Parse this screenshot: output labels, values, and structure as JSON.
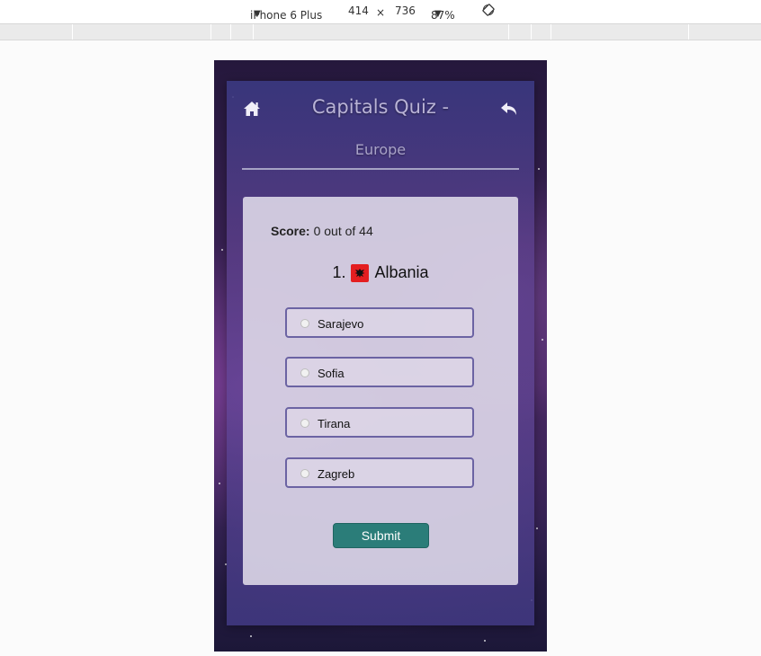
{
  "devtools": {
    "device": "iPhone 6 Plus",
    "width": "414",
    "times": "×",
    "height": "736",
    "zoom": "87%",
    "caret": "▼"
  },
  "header": {
    "title": "Capitals Quiz -",
    "subtitle": "Europe"
  },
  "quiz": {
    "score_label": "Score:",
    "score_value": "0 out of 44",
    "question_number": "1.",
    "country": "Albania",
    "options": [
      "Sarajevo",
      "Sofia",
      "Tirana",
      "Zagreb"
    ],
    "submit_label": "Submit"
  },
  "icons": {
    "home": "home-icon",
    "back": "back-arrow-icon",
    "rotate": "rotate-icon",
    "flag": "albania-flag-icon"
  },
  "colors": {
    "submit": "#2b7d79",
    "option_border": "#6b63a3",
    "flag_red": "#e41e20"
  }
}
